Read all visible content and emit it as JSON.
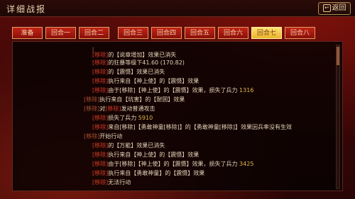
{
  "title": "详细战报",
  "back_label": "返回",
  "tabs": [
    {
      "label": "准备",
      "active": false
    },
    {
      "label": "回合一",
      "active": false
    },
    {
      "label": "回合二",
      "active": false
    },
    {
      "label": "回合三",
      "active": false
    },
    {
      "label": "回合四",
      "active": false
    },
    {
      "label": "回合五",
      "active": false
    },
    {
      "label": "回合六",
      "active": false
    },
    {
      "label": "回合七",
      "active": true
    },
    {
      "label": "回合八",
      "active": false
    }
  ],
  "log": [
    {
      "tag": "[",
      "pre": "",
      "hl": "",
      "mid": "",
      "text": "",
      "gold": ""
    },
    {
      "tag": "",
      "pre": "",
      "hl": "[移除]",
      "mid": "的",
      "text": "【说章增加】效果已消失",
      "gold": ""
    },
    {
      "tag": "",
      "pre": "",
      "hl": "[移除]",
      "mid": "的",
      "text": "狂暴等级下41.60 (170.82)",
      "gold": ""
    },
    {
      "tag": "",
      "pre": "",
      "hl": "[移除]",
      "mid": "的",
      "text": "【震慑】效果已消失",
      "gold": ""
    },
    {
      "tag": "",
      "pre": "",
      "hl": "[移除]",
      "mid": "",
      "text": "执行来自【神上使】的【震慑】效果",
      "gold": ""
    },
    {
      "tag": "",
      "pre": "",
      "hl": "[移除]",
      "mid": "",
      "text": "由于[移除]【神上使】的【震慑】效果，损失了兵力",
      "gold": "1316"
    },
    {
      "tag": "[移除]",
      "pre": "",
      "hl": "",
      "mid": "",
      "text": "执行来自【坑害】的【耐固】效果",
      "gold": ""
    },
    {
      "tag": "[移除]",
      "pre": "对",
      "hl": "[移除]",
      "mid": "",
      "text": "发动普通攻击",
      "gold": ""
    },
    {
      "tag": "",
      "pre": "",
      "hl": "[移除]",
      "mid": "",
      "text": "损失了兵力",
      "gold": "5910"
    },
    {
      "tag": "",
      "pre": "",
      "hl": "[移除]",
      "mid": "",
      "text": "来自[移除]【勇敢神童[移除]】的【勇敢神童[移除]】效果因兵率没有生效",
      "gold": ""
    },
    {
      "tag": "[移除]",
      "pre": "",
      "hl": "",
      "mid": "",
      "text": "开始行动",
      "gold": ""
    },
    {
      "tag": "",
      "pre": "",
      "hl": "[移除]",
      "mid": "的",
      "text": "【万能】效果已消失",
      "gold": ""
    },
    {
      "tag": "",
      "pre": "",
      "hl": "[移除]",
      "mid": "",
      "text": "执行来自【神上使】的【震慑】效果",
      "gold": ""
    },
    {
      "tag": "",
      "pre": "",
      "hl": "[移除]",
      "mid": "",
      "text": "由于[移除]【神上使】的【震慑】效果，损失了兵力",
      "gold": "3425"
    },
    {
      "tag": "",
      "pre": "",
      "hl": "[移除]",
      "mid": "",
      "text": "执行来自【勇敢神童】的【震慑】效果",
      "gold": ""
    },
    {
      "tag": "",
      "pre": "",
      "hl": "[移除]",
      "mid": "",
      "text": "无法行动",
      "gold": ""
    }
  ]
}
